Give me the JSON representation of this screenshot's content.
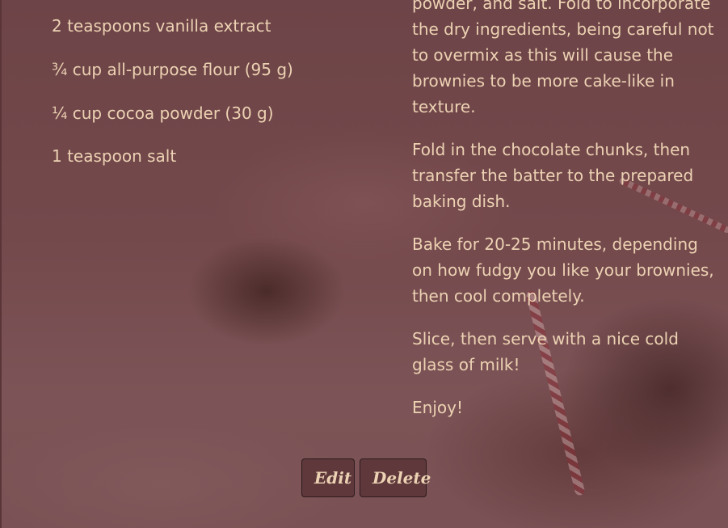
{
  "ingredients": [
    "2 teaspoons vanilla extract",
    "¾ cup all-purpose flour (95 g)",
    "¼ cup cocoa powder (30 g)",
    "1 teaspoon salt"
  ],
  "steps": [
    "powder, and salt. Fold to incorporate the dry ingredients, being careful not to overmix as this will cause the brownies to be more cake-like in texture.",
    "Fold in the chocolate chunks, then transfer the batter to the prepared baking dish.",
    "Bake for 20-25 minutes, depending on how fudgy you like your brownies, then cool completely.",
    "Slice, then serve with a nice cold glass of milk!",
    "Enjoy!"
  ],
  "actions": {
    "edit_label": "Edit",
    "delete_label": "Delete"
  }
}
